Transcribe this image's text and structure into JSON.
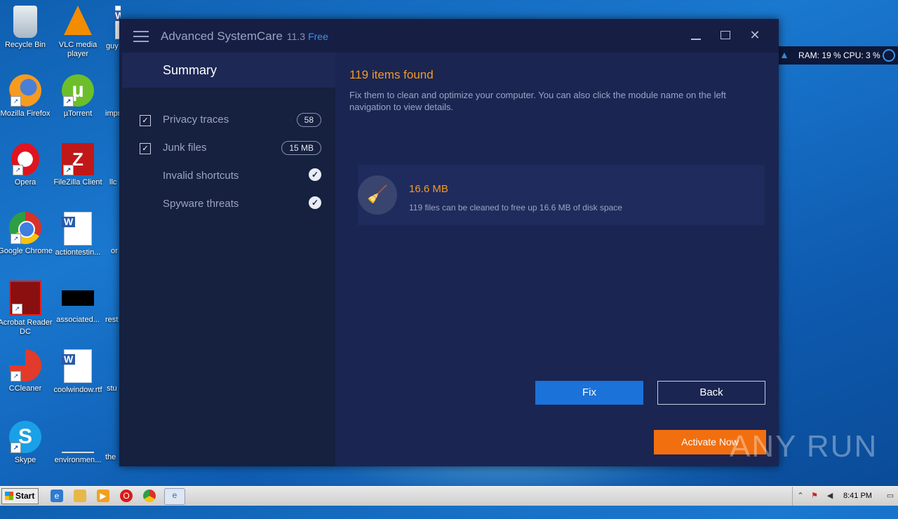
{
  "desktop": {
    "icons": [
      {
        "label": "Recycle Bin"
      },
      {
        "label": "VLC media player"
      },
      {
        "label": "guy"
      },
      {
        "label": "Mozilla Firefox"
      },
      {
        "label": "µTorrent"
      },
      {
        "label": "impr"
      },
      {
        "label": "Opera"
      },
      {
        "label": "FileZilla Client"
      },
      {
        "label": "llc"
      },
      {
        "label": "Google Chrome"
      },
      {
        "label": "actiontestin..."
      },
      {
        "label": "or"
      },
      {
        "label": "Acrobat Reader DC"
      },
      {
        "label": "associated..."
      },
      {
        "label": "rest"
      },
      {
        "label": "CCleaner"
      },
      {
        "label": "coolwindow.rtf"
      },
      {
        "label": "stu"
      },
      {
        "label": "Skype"
      },
      {
        "label": "environmen..."
      },
      {
        "label": "the"
      }
    ]
  },
  "app": {
    "title": "Advanced SystemCare",
    "version": "11.3",
    "edition": "Free",
    "sidebar": {
      "summary_label": "Summary",
      "items": [
        {
          "label": "Privacy traces",
          "checked": true,
          "badge": "58"
        },
        {
          "label": "Junk files",
          "checked": true,
          "badge": "15 MB"
        },
        {
          "label": "Invalid shortcuts",
          "status": "ok"
        },
        {
          "label": "Spyware threats",
          "status": "ok"
        }
      ]
    },
    "main": {
      "found_title": "119 items found",
      "found_desc": "Fix them to clean and optimize your computer. You can also click the module name on the left navigation to view details.",
      "result": {
        "size": "16.6 MB",
        "text": "119 files can be cleaned to free up 16.6 MB of disk space",
        "icon": "broom-icon"
      },
      "fix_label": "Fix",
      "back_label": "Back",
      "activate_label": "Activate Now"
    }
  },
  "gadget": {
    "text": "RAM: 19 %  CPU: 3 %"
  },
  "watermark": "ANY RUN",
  "taskbar": {
    "start_label": "Start",
    "clock": "8:41 PM"
  },
  "colors": {
    "accent_orange": "#f39a22",
    "fix_blue": "#1b72d9",
    "activate_orange": "#f26f0f",
    "app_bg": "#1a2552"
  }
}
